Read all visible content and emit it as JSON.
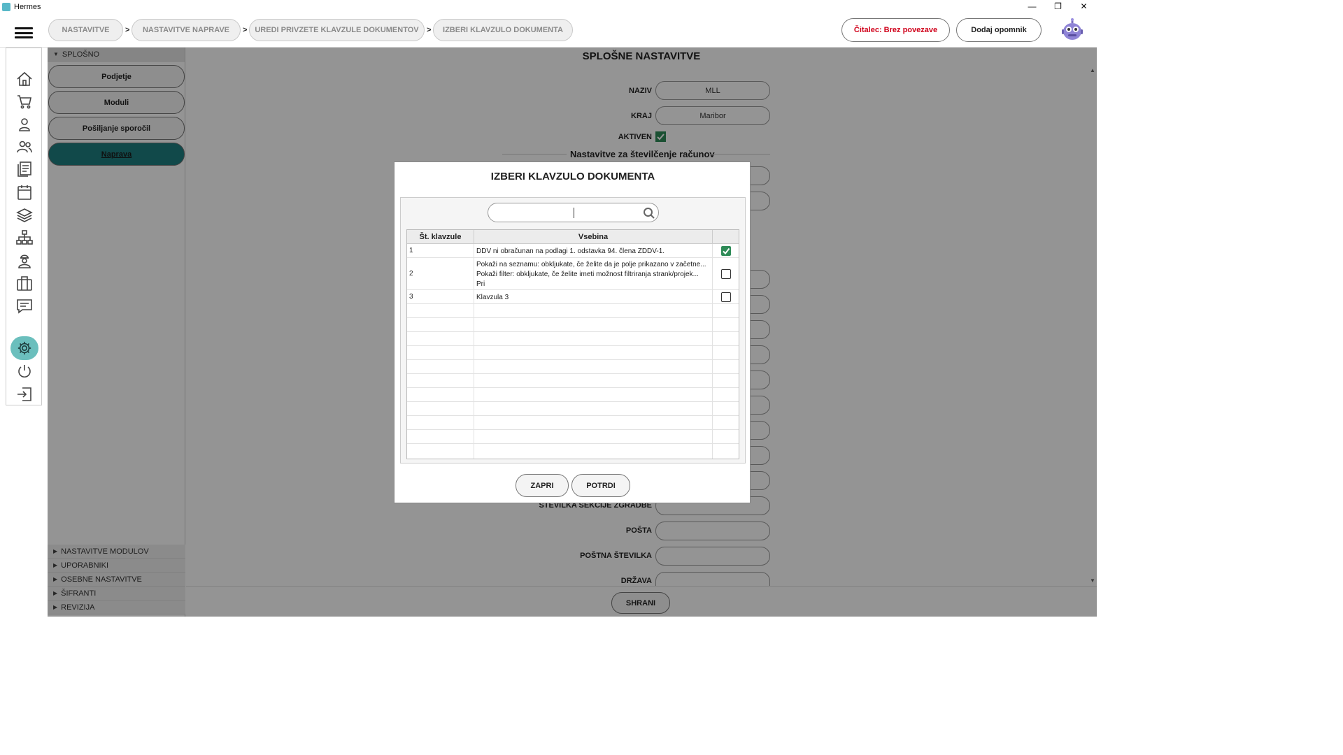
{
  "window": {
    "title": "Hermes",
    "controls": [
      "—",
      "❐",
      "✕"
    ]
  },
  "header": {
    "breadcrumbs": [
      {
        "label": "NASTAVITVE"
      },
      {
        "label": "NASTAVITVE NAPRAVE"
      },
      {
        "label": "UREDI PRIVZETE KLAVZULE DOKUMENTOV"
      },
      {
        "label": "IZBERI KLAVZULO DOKUMENTA"
      }
    ],
    "separator": ">",
    "reader_status": "Čitalec: Brez povezave",
    "reader_status_color": "#d0021b",
    "add_reminder": "Dodaj opomnik"
  },
  "rail": {
    "icons": [
      "home-icon",
      "cart-icon",
      "user-icon",
      "users-icon",
      "documents-icon",
      "calendar-icon",
      "layers-icon",
      "hierarchy-icon",
      "worker-icon",
      "briefcase-icon",
      "chat-icon",
      "settings-icon",
      "power-icon",
      "logout-icon"
    ],
    "active_icon": "settings-icon",
    "accent": "#6bbfbd"
  },
  "tree": {
    "top_section": "SPLOŠNO",
    "items": [
      {
        "label": "Podjetje"
      },
      {
        "label": "Moduli"
      },
      {
        "label": "Pošiljanje sporočil"
      },
      {
        "label": "Naprava"
      }
    ],
    "selected": "Naprava",
    "bottom_sections": [
      "NASTAVITVE MODULOV",
      "UPORABNIKI",
      "OSEBNE NASTAVITVE",
      "ŠIFRANTI",
      "REVIZIJA"
    ]
  },
  "main": {
    "title": "SPLOŠNE NASTAVITVE",
    "fields": {
      "naziv_label": "NAZIV",
      "naziv_value": "MLL",
      "kraj_label": "KRAJ",
      "kraj_value": "Maribor",
      "aktiven_label": "AKTIVEN",
      "aktiven_checked": true,
      "sekcija_label": "ŠTEVILKA SEKCIJE ZGRADBE",
      "posta_label": "POŠTA",
      "postna_label": "POŠTNA ŠTEVILKA",
      "drzava_label": "DRŽAVA"
    },
    "numbering_section": "Nastavitve za številčenje računov",
    "save_button": "SHRANI"
  },
  "modal": {
    "title": "IZBERI KLAVZULO DOKUMENTA",
    "search": {
      "value": "",
      "placeholder": ""
    },
    "columns": {
      "number": "Št. klavzule",
      "content": "Vsebina"
    },
    "rows": [
      {
        "number": "1",
        "lines": [
          "DDV ni obračunan na podlagi 1. odstavka 94. člena ZDDV-1."
        ],
        "checked": true
      },
      {
        "number": "2",
        "lines": [
          "Pokaži na seznamu: obkljukate, če želite da je polje prikazano v začetne...",
          "Pokaži filter: obkljukate, če želite imeti možnost filtriranja strank/projek...",
          "Pri"
        ],
        "checked": false
      },
      {
        "number": "3",
        "lines": [
          "Klavzula 3"
        ],
        "checked": false
      }
    ],
    "close_button": "ZAPRI",
    "confirm_button": "POTRDI",
    "check_color": "#2e8b57"
  }
}
